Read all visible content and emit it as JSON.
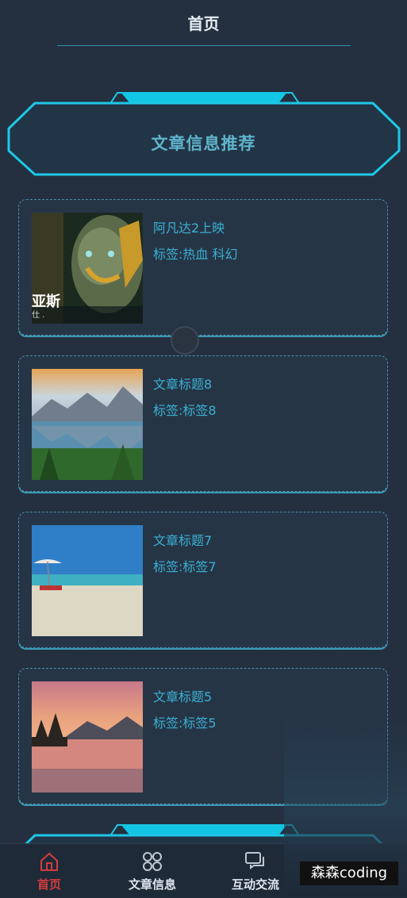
{
  "header": {
    "title": "首页"
  },
  "section": {
    "title": "文章信息推荐"
  },
  "articles": [
    {
      "title": "阿凡达2上映",
      "tags": "标签:热血 科幻",
      "overlay": "亚斯",
      "overlay_sub": "仕 ."
    },
    {
      "title": "文章标题8",
      "tags": "标签:标签8"
    },
    {
      "title": "文章标题7",
      "tags": "标签:标签7"
    },
    {
      "title": "文章标题5",
      "tags": "标签:标签5"
    }
  ],
  "tabbar": {
    "items": [
      {
        "label": "首页",
        "icon": "home-icon",
        "active": true
      },
      {
        "label": "文章信息",
        "icon": "grid-icon"
      },
      {
        "label": "互动交流",
        "icon": "chat-icon"
      }
    ]
  },
  "watermark": "森森coding",
  "colors": {
    "accent": "#1ec8e6",
    "background": "#243040",
    "text": "#3bb4d4",
    "active_tab": "#d43c3c"
  }
}
